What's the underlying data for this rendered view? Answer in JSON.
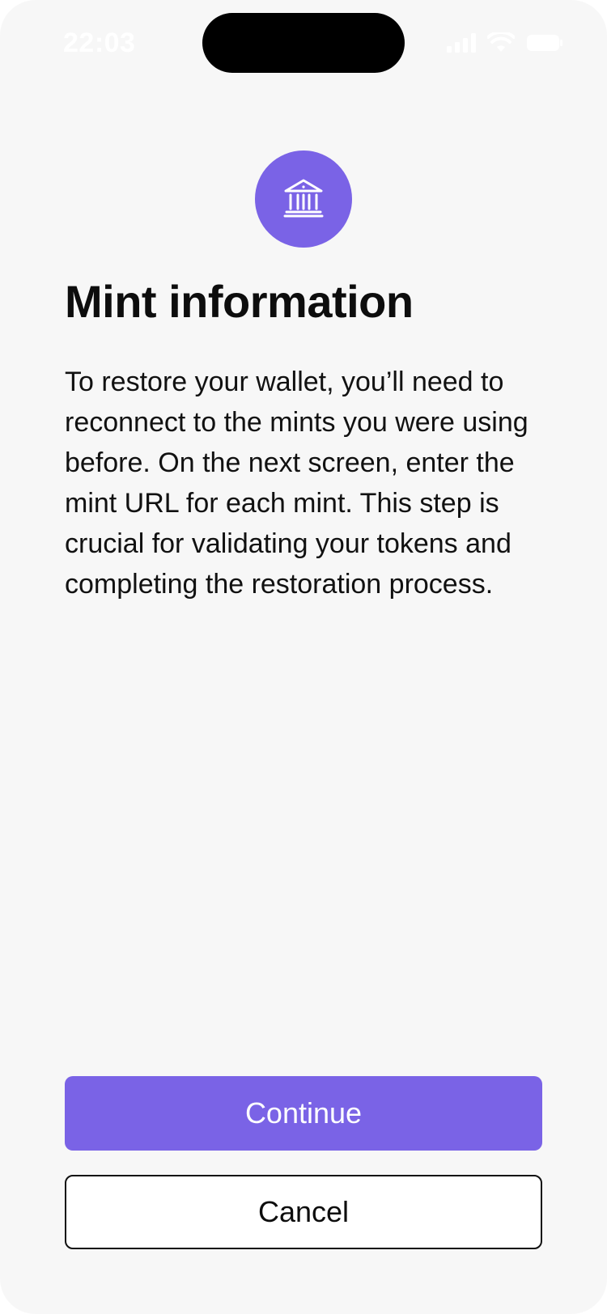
{
  "status_bar": {
    "time": "22:03",
    "icons": [
      "cellular-signal-icon",
      "wifi-icon",
      "battery-icon"
    ]
  },
  "hero": {
    "icon": "bank-icon",
    "icon_background": "#7a63e6"
  },
  "content": {
    "title": "Mint information",
    "description": "To restore your wallet, you’ll need to reconnect to the mints you were using before. On the next screen, enter the mint URL for each mint. This step is crucial for validating your tokens and completing the restoration process."
  },
  "actions": {
    "continue_label": "Continue",
    "cancel_label": "Cancel",
    "accent_color": "#7a63e6"
  }
}
